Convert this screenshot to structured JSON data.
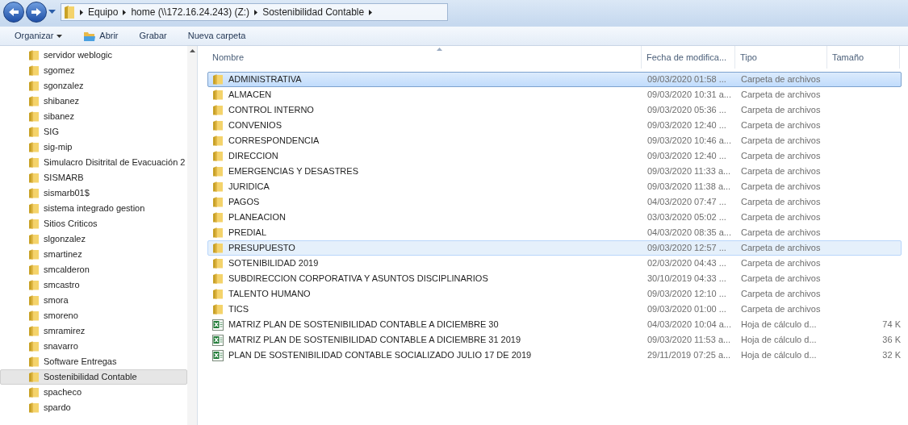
{
  "address_bar": {
    "breadcrumbs": [
      "Equipo",
      "home (\\\\172.16.24.243) (Z:)",
      "Sostenibilidad Contable"
    ]
  },
  "toolbar": [
    {
      "label": "Organizar",
      "kind": "dropdown"
    },
    {
      "label": "Abrir",
      "kind": "open"
    },
    {
      "label": "Grabar",
      "kind": "plain"
    },
    {
      "label": "Nueva carpeta",
      "kind": "plain"
    }
  ],
  "sidebar": {
    "items": [
      {
        "label": "servidor weblogic",
        "selected": false
      },
      {
        "label": "sgomez",
        "selected": false
      },
      {
        "label": "sgonzalez",
        "selected": false
      },
      {
        "label": "shibanez",
        "selected": false
      },
      {
        "label": "sibanez",
        "selected": false
      },
      {
        "label": "SIG",
        "selected": false
      },
      {
        "label": "sig-mip",
        "selected": false
      },
      {
        "label": "Simulacro Disitrital de Evacuación 2",
        "selected": false
      },
      {
        "label": "SISMARB",
        "selected": false
      },
      {
        "label": "sismarb01$",
        "selected": false
      },
      {
        "label": "sistema integrado gestion",
        "selected": false
      },
      {
        "label": "Sitios Criticos",
        "selected": false
      },
      {
        "label": "slgonzalez",
        "selected": false
      },
      {
        "label": "smartinez",
        "selected": false
      },
      {
        "label": "smcalderon",
        "selected": false
      },
      {
        "label": "smcastro",
        "selected": false
      },
      {
        "label": "smora",
        "selected": false
      },
      {
        "label": "smoreno",
        "selected": false
      },
      {
        "label": "smramirez",
        "selected": false
      },
      {
        "label": "snavarro",
        "selected": false
      },
      {
        "label": "Software Entregas",
        "selected": false
      },
      {
        "label": "Sostenibilidad Contable",
        "selected": true
      },
      {
        "label": "spacheco",
        "selected": false
      },
      {
        "label": "spardo",
        "selected": false
      }
    ]
  },
  "table": {
    "columns": [
      "Nombre",
      "Fecha de modifica...",
      "Tipo",
      "Tamaño"
    ],
    "rows": [
      {
        "kind": "folder",
        "name": "ADMINISTRATIVA",
        "date": "09/03/2020 01:58 ...",
        "type": "Carpeta de archivos",
        "selected": true,
        "hovered": false
      },
      {
        "kind": "folder",
        "name": "ALMACEN",
        "date": "09/03/2020 10:31 a...",
        "type": "Carpeta de archivos",
        "selected": false,
        "hovered": false
      },
      {
        "kind": "folder",
        "name": "CONTROL INTERNO",
        "date": "09/03/2020 05:36 ...",
        "type": "Carpeta de archivos",
        "selected": false,
        "hovered": false
      },
      {
        "kind": "folder",
        "name": "CONVENIOS",
        "date": "09/03/2020 12:40 ...",
        "type": "Carpeta de archivos",
        "selected": false,
        "hovered": false
      },
      {
        "kind": "folder",
        "name": "CORRESPONDENCIA",
        "date": "09/03/2020 10:46 a...",
        "type": "Carpeta de archivos",
        "selected": false,
        "hovered": false
      },
      {
        "kind": "folder",
        "name": "DIRECCION",
        "date": "09/03/2020 12:40 ...",
        "type": "Carpeta de archivos",
        "selected": false,
        "hovered": false
      },
      {
        "kind": "folder",
        "name": "EMERGENCIAS Y DESASTRES",
        "date": "09/03/2020 11:33 a...",
        "type": "Carpeta de archivos",
        "selected": false,
        "hovered": false
      },
      {
        "kind": "folder",
        "name": "JURIDICA",
        "date": "09/03/2020 11:38 a...",
        "type": "Carpeta de archivos",
        "selected": false,
        "hovered": false
      },
      {
        "kind": "folder",
        "name": "PAGOS",
        "date": "04/03/2020 07:47 ...",
        "type": "Carpeta de archivos",
        "selected": false,
        "hovered": false
      },
      {
        "kind": "folder",
        "name": "PLANEACION",
        "date": "03/03/2020 05:02 ...",
        "type": "Carpeta de archivos",
        "selected": false,
        "hovered": false
      },
      {
        "kind": "folder",
        "name": "PREDIAL",
        "date": "04/03/2020 08:35 a...",
        "type": "Carpeta de archivos",
        "selected": false,
        "hovered": false
      },
      {
        "kind": "folder",
        "name": "PRESUPUESTO",
        "date": "09/03/2020 12:57 ...",
        "type": "Carpeta de archivos",
        "selected": false,
        "hovered": true
      },
      {
        "kind": "folder",
        "name": "SOTENIBILIDAD 2019",
        "date": "02/03/2020 04:43 ...",
        "type": "Carpeta de archivos",
        "selected": false,
        "hovered": false
      },
      {
        "kind": "folder",
        "name": "SUBDIRECCION CORPORATIVA Y ASUNTOS DISCIPLINARIOS",
        "date": "30/10/2019 04:33 ...",
        "type": "Carpeta de archivos",
        "selected": false,
        "hovered": false
      },
      {
        "kind": "folder",
        "name": "TALENTO HUMANO",
        "date": "09/03/2020 12:10 ...",
        "type": "Carpeta de archivos",
        "selected": false,
        "hovered": false
      },
      {
        "kind": "folder",
        "name": "TICS",
        "date": "09/03/2020 01:00 ...",
        "type": "Carpeta de archivos",
        "selected": false,
        "hovered": false
      },
      {
        "kind": "spreadsheet",
        "name": "MATRIZ PLAN DE SOSTENIBILIDAD CONTABLE A DICIEMBRE 30",
        "date": "04/03/2020 10:04 a...",
        "type": "Hoja de cálculo d...",
        "size": "74 K",
        "selected": false,
        "hovered": false
      },
      {
        "kind": "spreadsheet",
        "name": "MATRIZ PLAN DE SOSTENIBILIDAD CONTABLE A DICIEMBRE 31 2019",
        "date": "09/03/2020 11:53 a...",
        "type": "Hoja de cálculo d...",
        "size": "36 K",
        "selected": false,
        "hovered": false
      },
      {
        "kind": "spreadsheet",
        "name": "PLAN DE SOSTENIBILIDAD CONTABLE SOCIALIZADO JULIO 17 DE 2019",
        "date": "29/11/2019 07:25 a...",
        "type": "Hoja de cálculo d...",
        "size": "32 K",
        "selected": false,
        "hovered": false
      }
    ]
  }
}
